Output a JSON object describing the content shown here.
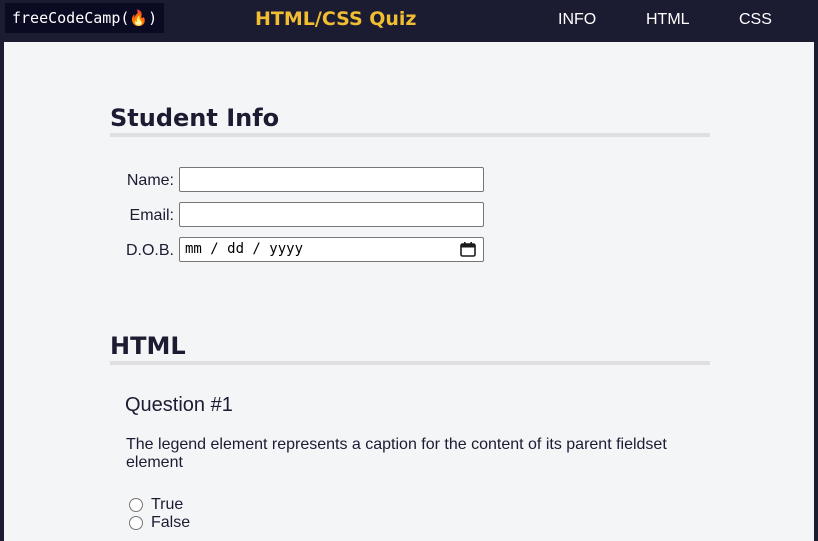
{
  "header": {
    "logo": "freeCodeCamp(🔥)",
    "title": "HTML/CSS Quiz",
    "nav": [
      {
        "label": "INFO"
      },
      {
        "label": "HTML"
      },
      {
        "label": "CSS"
      }
    ]
  },
  "student_info": {
    "heading": "Student Info",
    "name_label": "Name:",
    "email_label": "Email:",
    "dob_label": "D.O.B.",
    "dob_placeholder": "mm / dd / yyyy"
  },
  "html_section": {
    "heading": "HTML",
    "question_title": "Question #1",
    "question_text": "The legend element represents a caption for the content of its parent fieldset element",
    "options": [
      {
        "label": "True"
      },
      {
        "label": "False"
      }
    ]
  },
  "colors": {
    "nav_bg": "#1b1b32",
    "accent": "#f1be32",
    "page_bg": "#f4f5f7"
  }
}
